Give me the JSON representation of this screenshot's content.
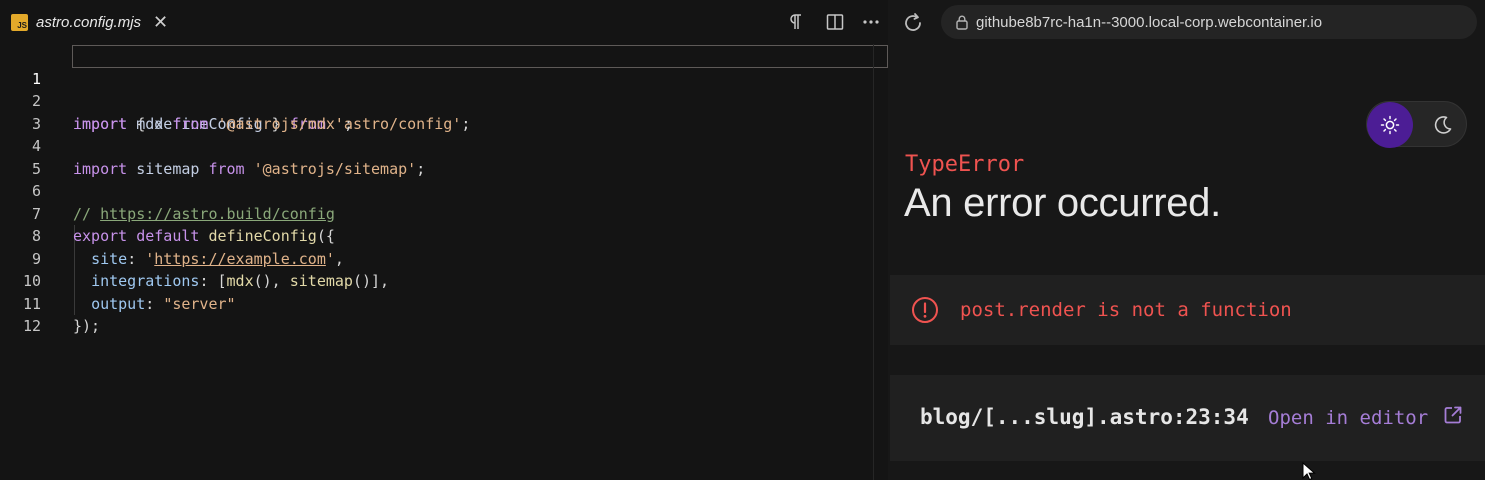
{
  "editor": {
    "tab": {
      "badge": "JS",
      "title": "astro.config.mjs",
      "close": "✕"
    },
    "lines": [
      {
        "n": "1"
      },
      {
        "n": "2"
      },
      {
        "n": "3"
      },
      {
        "n": "4"
      },
      {
        "n": "5"
      },
      {
        "n": "6"
      },
      {
        "n": "7"
      },
      {
        "n": "8"
      },
      {
        "n": "9"
      },
      {
        "n": "10"
      },
      {
        "n": "11"
      },
      {
        "n": "12"
      }
    ],
    "code": {
      "l1": {
        "k1": "import",
        "p1": " { ",
        "id": "defineConfig",
        "p2": " } ",
        "k2": "from",
        "sp": " ",
        "str": "'astro/config'",
        "end": ";"
      },
      "l2": {
        "k1": "import",
        "id": " mdx ",
        "k2": "from",
        "sp": " ",
        "str": "'@astrojs/mdx'",
        "end": ";"
      },
      "l4": {
        "k1": "import",
        "id": " sitemap ",
        "k2": "from",
        "sp": " ",
        "str": "'@astrojs/sitemap'",
        "end": ";"
      },
      "l6": {
        "com": "// ",
        "link": "https://astro.build/config"
      },
      "l7": {
        "k1": "export",
        "sp": " ",
        "k2": "default",
        "sp2": " ",
        "fn": "defineConfig",
        "end": "({"
      },
      "l8": {
        "prop": "site",
        "colon": ": ",
        "q1": "'",
        "url": "https://example.com",
        "q2": "'",
        "end": ","
      },
      "l9": {
        "prop": "integrations",
        "colon": ": [",
        "fn1": "mdx",
        "p1": "(), ",
        "fn2": "sitemap",
        "end": "()],"
      },
      "l10": {
        "prop": "output",
        "colon": ": ",
        "str": "\"server\""
      },
      "l11": {
        "end": "});"
      }
    }
  },
  "preview": {
    "url": "githube8b7rc-ha1n--3000.local-corp.webcontainer.io",
    "error_type": "TypeError",
    "error_title": "An error occurred.",
    "message": "post.render is not a function",
    "location": "blog/[...slug].astro:23:34",
    "open_in_editor": "Open in editor"
  },
  "colors": {
    "accent_purple": "#4c1d95",
    "error_red": "#ef5350",
    "link_purple": "#a57dd6"
  },
  "icons": [
    "javascript-file-icon",
    "close-icon",
    "paragraph-icon",
    "split-editor-icon",
    "more-icon",
    "reload-icon",
    "lock-icon",
    "sun-icon",
    "moon-icon",
    "error-circle-icon",
    "external-link-icon",
    "mouse-cursor-icon"
  ]
}
